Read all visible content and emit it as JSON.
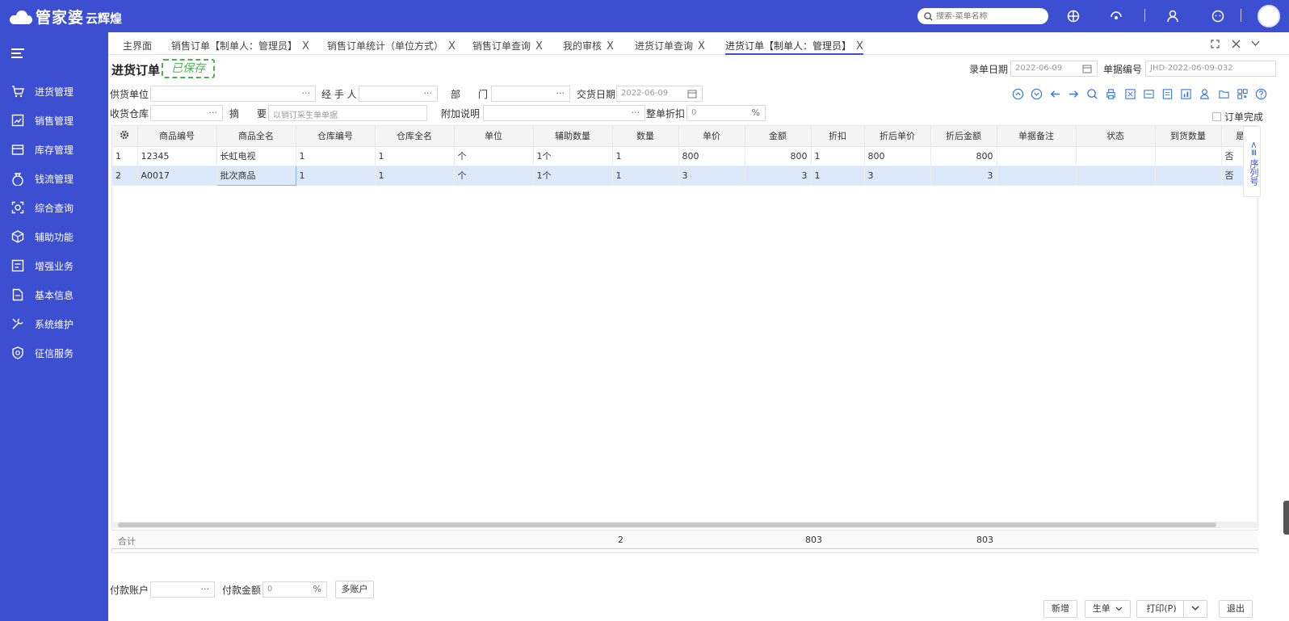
{
  "app": {
    "brand": "管家婆",
    "brand_sub": "云辉煌"
  },
  "search": {
    "placeholder": "搜索-菜单名称"
  },
  "sidebar": {
    "items": [
      {
        "label": "进货管理",
        "icon": "cart-icon"
      },
      {
        "label": "销售管理",
        "icon": "sales-icon"
      },
      {
        "label": "库存管理",
        "icon": "box-icon"
      },
      {
        "label": "钱流管理",
        "icon": "money-bag-icon"
      },
      {
        "label": "综合查询",
        "icon": "query-icon"
      },
      {
        "label": "辅助功能",
        "icon": "cube-icon"
      },
      {
        "label": "增强业务",
        "icon": "document-icon"
      },
      {
        "label": "基本信息",
        "icon": "file-icon"
      },
      {
        "label": "系统维护",
        "icon": "tools-icon"
      },
      {
        "label": "征信服务",
        "icon": "shield-icon"
      }
    ]
  },
  "tabs": [
    {
      "label": "主界面",
      "closable": false
    },
    {
      "label": "销售订单【制单人：管理员】",
      "closable": true
    },
    {
      "label": "销售订单统计（单位方式）",
      "closable": true
    },
    {
      "label": "销售订单查询",
      "closable": true
    },
    {
      "label": "我的审核",
      "closable": true
    },
    {
      "label": "进货订单查询",
      "closable": true
    },
    {
      "label": "进货订单【制单人：管理员】",
      "closable": true,
      "active": true
    }
  ],
  "close_symbol": "X",
  "form": {
    "title": "进货订单",
    "stamp": "已保存",
    "entry_date_label": "录单日期",
    "entry_date": "2022-06-09",
    "doc_no_label": "单据编号",
    "doc_no": "JHD-2022-06-09-032",
    "supplier_label": "供货单位",
    "handler_label": "经 手 人",
    "dept_label_1": "部",
    "dept_label_2": "门",
    "delivery_date_label": "交货日期",
    "delivery_date": "2022-06-09",
    "warehouse_label": "收货仓库",
    "summary_label_1": "摘",
    "summary_label_2": "要",
    "summary_placeholder": "以销订采生单单据",
    "note_label": "附加说明",
    "discount_label": "整单折扣",
    "discount_value": "0",
    "percent": "%",
    "ellipsis": "···",
    "order_complete_label": "订单完成"
  },
  "grid": {
    "columns": [
      "",
      "商品编号",
      "商品全名",
      "仓库编号",
      "仓库全名",
      "单位",
      "辅助数量",
      "数量",
      "单价",
      "金额",
      "折扣",
      "折后单价",
      "折后金额",
      "单据备注",
      "状态",
      "到货数量",
      "是"
    ],
    "rows": [
      [
        "1",
        "12345",
        "长虹电视",
        "1",
        "1",
        "个",
        "1个",
        "1",
        "800",
        "800",
        "1",
        "800",
        "800",
        "",
        "",
        "",
        "否"
      ],
      [
        "2",
        "A0017",
        "批次商品",
        "1",
        "1",
        "个",
        "1个",
        "1",
        "3",
        "3",
        "1",
        "3",
        "3",
        "",
        "",
        "",
        "否"
      ]
    ],
    "total_label": "合计",
    "total_qty": "2",
    "total_amount": "803",
    "total_discount_amount": "803",
    "side_panel": "序列号"
  },
  "payment": {
    "account_label": "付款账户",
    "amount_label": "付款金额",
    "amount_value": "0",
    "multi_button": "多账户"
  },
  "footer": {
    "new": "新增",
    "gen": "生单",
    "print": "打印(P)",
    "exit": "退出"
  },
  "colors": {
    "primary": "#3c4fd1",
    "selected_row": "#dbe9fa",
    "stamp": "#4cb050"
  }
}
